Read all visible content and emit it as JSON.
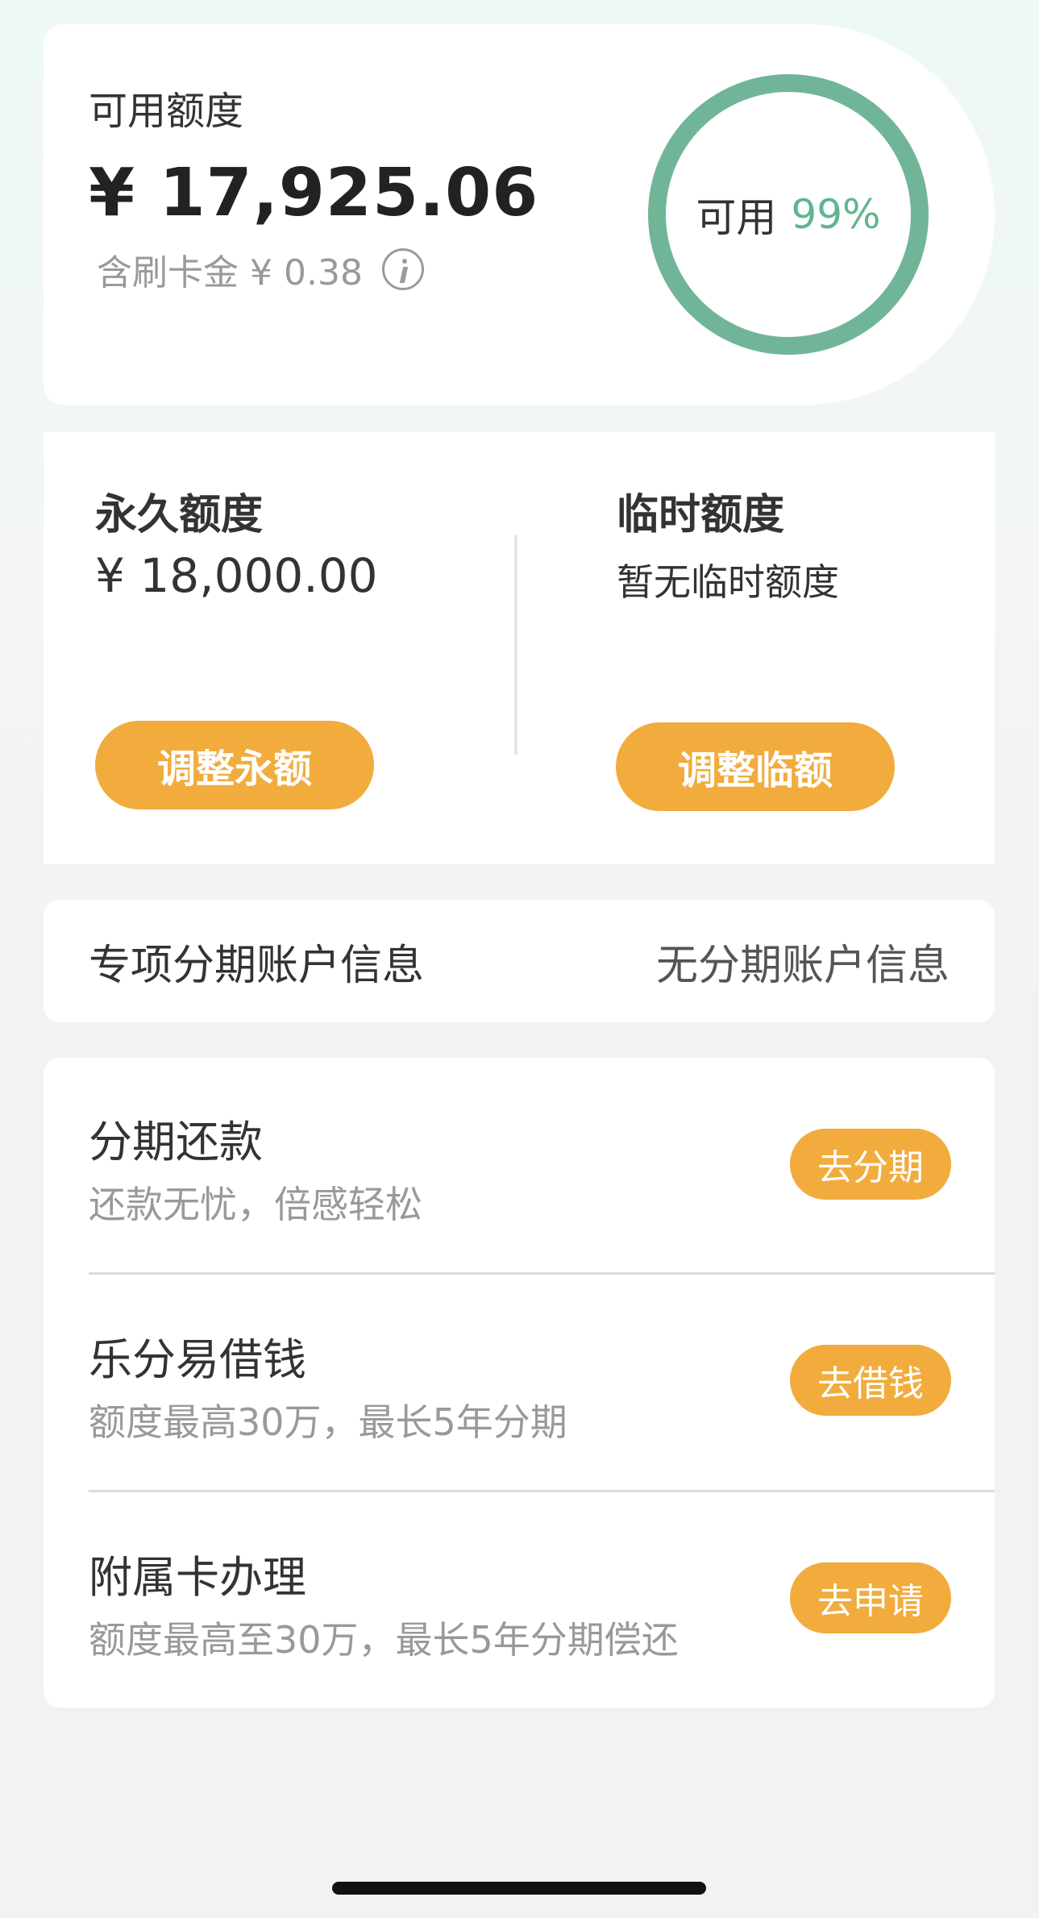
{
  "available": {
    "label": "可用额度",
    "amount": "¥ 17,925.06",
    "swipe_note": "含刷卡金 ¥ 0.38",
    "ring_label": "可用",
    "ring_percent_text": "99%",
    "ring_percent_value": 99
  },
  "limits": {
    "permanent": {
      "title": "永久额度",
      "value": "¥ 18,000.00",
      "button": "调整永额"
    },
    "temporary": {
      "title": "临时额度",
      "value": "暂无临时额度",
      "button": "调整临额"
    }
  },
  "installment_account": {
    "label": "专项分期账户信息",
    "value": "无分期账户信息"
  },
  "services": [
    {
      "title": "分期还款",
      "desc": "还款无忧，倍感轻松",
      "button": "去分期"
    },
    {
      "title": "乐分易借钱",
      "desc": "额度最高30万，最长5年分期",
      "button": "去借钱"
    },
    {
      "title": "附属卡办理",
      "desc": "额度最高至30万，最长5年分期偿还",
      "button": "去申请"
    }
  ],
  "colors": {
    "accent_orange": "#f1ac3d",
    "ring_green": "#71b598",
    "percent_green": "#5fb58e"
  },
  "icons": {
    "info": "info-icon"
  }
}
